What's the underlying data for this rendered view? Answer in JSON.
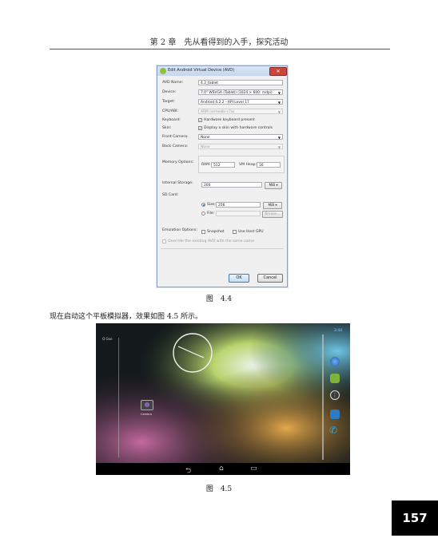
{
  "header": {
    "text": "第 2 章　先从看得到的入手，探究活动"
  },
  "dialog": {
    "title": "Edit Android Virtual Device (AVD)",
    "close_label": "✕",
    "fields": {
      "avd_name": {
        "label": "AVD Name:",
        "value": "4.2_tablet"
      },
      "device": {
        "label": "Device:",
        "value": "7.0\" WSVGA (Tablet) (1024 × 600: mdpi)"
      },
      "target": {
        "label": "Target:",
        "value": "Android 4.2.2 - API Level 17"
      },
      "cpu": {
        "label": "CPU/ABI:",
        "value": "ARM (armeabi-v7a)"
      },
      "keyboard": {
        "label": "Keyboard:",
        "option": "Hardware keyboard present",
        "checked": true
      },
      "skin": {
        "label": "Skin:",
        "option": "Display a skin with hardware controls",
        "checked": true
      },
      "front_camera": {
        "label": "Front Camera:",
        "value": "None"
      },
      "back_camera": {
        "label": "Back Camera:",
        "value": "None"
      },
      "memory": {
        "label": "Memory Options:",
        "ram_label": "RAM:",
        "ram_value": "512",
        "vm_label": "VM Heap:",
        "vm_value": "16"
      },
      "internal_storage": {
        "label": "Internal Storage:",
        "value": "200",
        "unit": "MiB"
      },
      "sd_card": {
        "label": "SD Card:",
        "size_label": "Size:",
        "size_value": "256",
        "size_unit": "MiB",
        "file_label": "File:",
        "browse_label": "Browse..."
      },
      "emulation": {
        "label": "Emulation Options:",
        "snapshot": "Snapshot",
        "host_gpu": "Use Host GPU"
      },
      "override": "Override the existing AVD with the same name"
    },
    "ok_label": "OK",
    "cancel_label": "Cancel"
  },
  "figure1_caption": "图　4.4",
  "body_text": "现在启动这个平板模拟器，效果如图 4.5 所示。",
  "emulator": {
    "status_text": "3:44",
    "search_text": "Q Goo",
    "camera_label": "Camera"
  },
  "figure2_caption": "图　4.5",
  "page_number": "157"
}
